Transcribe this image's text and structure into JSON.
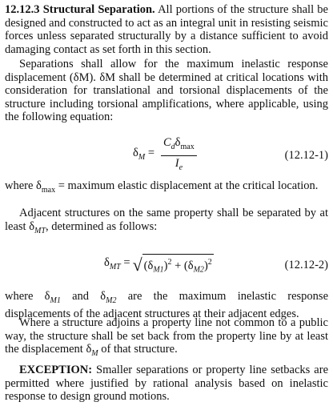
{
  "section": {
    "heading": "12.12.3 Structural Separation.",
    "p1_rest": " All portions of the structure shall be designed and constructed to act as an integral unit in resisting seismic forces unless separated structurally by a distance sufficient to avoid damaging contact as set forth in this section.",
    "p2": "Separations shall allow for the maximum inelastic response displacement (δM). δM shall be determined at critical locations with consideration for translational and torsional displacements of the structure including torsional amplifications, where applicable, using the following equation:",
    "eq1": {
      "lhs": "δM =",
      "numerator": "CdδMax",
      "denominator": "Ie",
      "number": "(12.12-1)"
    },
    "p3": "where δmax = maximum elastic displacement at the critical location.",
    "p4": "Adjacent structures on the same property shall be separated by at least δMT, determined as follows:",
    "eq2": {
      "expr": "δMT = √((δM1)² + (δM2)²)",
      "number": "(12.12-2)"
    },
    "p5": "where δM1 and δM2 are the maximum inelastic response displacements of the adjacent structures at their adjacent edges.",
    "p6": "Where a structure adjoins a property line not common to a public way, the structure shall be set back from the property line by at least the displacement δM of that structure.",
    "exception_label": "EXCEPTION:",
    "exception_rest": " Smaller separations or property line setbacks are permitted where justified by rational analysis based on inelastic response to design ground motions."
  }
}
